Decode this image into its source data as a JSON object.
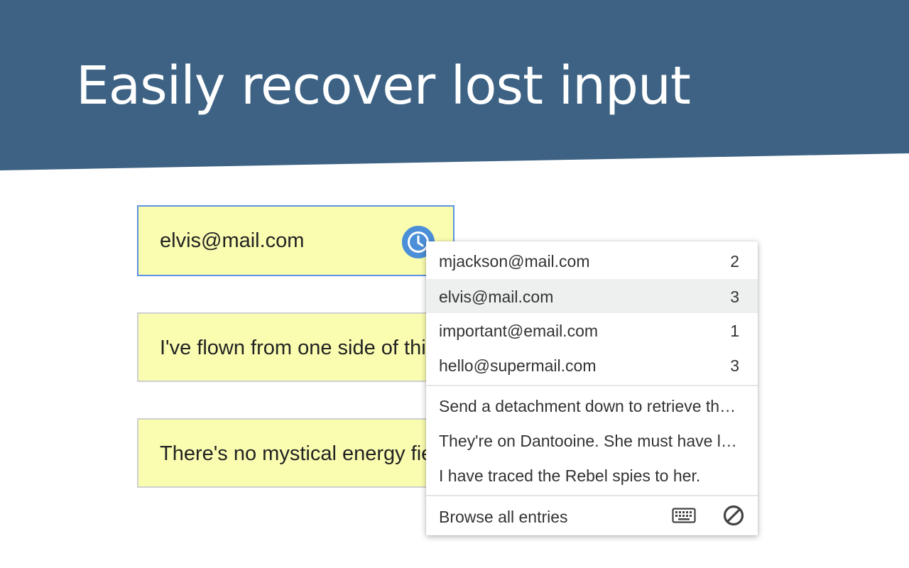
{
  "header": {
    "title": "Easily recover lost input"
  },
  "fields": [
    {
      "value": "elvis@mail.com"
    },
    {
      "value": "I've flown from one side of this galaxy to the other."
    },
    {
      "value": "There's no mystical energy field that controls my destiny."
    }
  ],
  "dropdown": {
    "emails": [
      {
        "label": "mjackson@mail.com",
        "count": "2"
      },
      {
        "label": "elvis@mail.com",
        "count": "3"
      },
      {
        "label": "important@email.com",
        "count": "1"
      },
      {
        "label": "hello@supermail.com",
        "count": "3"
      }
    ],
    "entries": [
      {
        "label": "Send a detachment down to retrieve them."
      },
      {
        "label": "They're on Dantooine. She must have lied."
      },
      {
        "label": "I have traced the Rebel spies to her."
      }
    ],
    "footer": {
      "browse_label": "Browse all entries"
    }
  },
  "icons": {
    "history": "clock-icon",
    "keyboard": "keyboard-icon",
    "disable": "block-icon"
  },
  "colors": {
    "banner": "#3d6284",
    "field_bg": "#fafdb0",
    "focus_border": "#5b93e2",
    "clock": "#4a8fd8",
    "selected_row": "#eef0f0"
  }
}
